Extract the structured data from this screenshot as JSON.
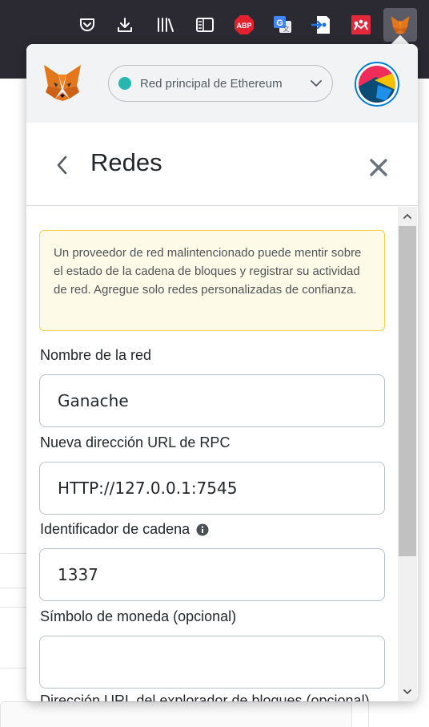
{
  "browser_toolbar": {
    "icons": [
      "pocket-icon",
      "download-icon",
      "library-icon",
      "sidebar-icon",
      "adblock-plus-icon",
      "google-translate-icon",
      "extension-arrow-icon",
      "mendeley-icon",
      "metamask-extension-icon"
    ],
    "adblock_text": "ABP"
  },
  "header": {
    "network_label": "Red principal de Ethereum",
    "network_color": "#29b6af"
  },
  "subheader": {
    "title": "Redes"
  },
  "warning": {
    "text": "Un proveedor de red malintencionado puede mentir sobre el estado de la cadena de bloques y registrar su actividad de red. Agregue solo redes personalizadas de confianza."
  },
  "form": {
    "network_name": {
      "label": "Nombre de la red",
      "value": "Ganache"
    },
    "rpc_url": {
      "label": "Nueva dirección URL de RPC",
      "value": "HTTP://127.0.0.1:7545"
    },
    "chain_id": {
      "label": "Identificador de cadena",
      "value": "1337"
    },
    "currency_symbol": {
      "label": "Símbolo de moneda (opcional)",
      "value": ""
    },
    "block_explorer": {
      "label": "Dirección URL del explorador de bloques (opcional)"
    }
  },
  "colors": {
    "accent_blue": "#037dd6",
    "warning_bg": "#fefae8",
    "warning_border": "#f8d24a",
    "toolbar_bg": "#2b2a33"
  }
}
